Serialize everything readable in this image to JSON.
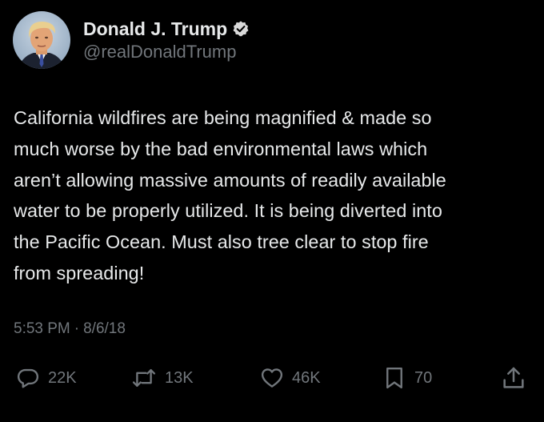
{
  "user": {
    "display_name": "Donald J. Trump",
    "handle": "@realDonaldTrump",
    "verified": true,
    "avatar_icon": "profile-photo"
  },
  "tweet": {
    "text": "California wildfires are being magnified & made so\nmuch worse by the bad environmental laws which\naren’t allowing massive amounts of readily available\nwater to be properly utilized. It is being diverted into\nthe Pacific Ocean. Must also tree clear to stop fire\nfrom spreading!",
    "time": "5:53 PM",
    "separator": "·",
    "date": "8/6/18"
  },
  "actions": {
    "reply_count": "22K",
    "retweet_count": "13K",
    "like_count": "46K",
    "bookmark_count": "70",
    "reply_icon": "reply-icon",
    "retweet_icon": "retweet-icon",
    "like_icon": "heart-icon",
    "bookmark_icon": "bookmark-icon",
    "share_icon": "share-icon"
  },
  "colors": {
    "background": "#000000",
    "text_primary": "#e7e9ea",
    "text_secondary": "#71767b",
    "verified_badge": "#d9d9d9"
  }
}
